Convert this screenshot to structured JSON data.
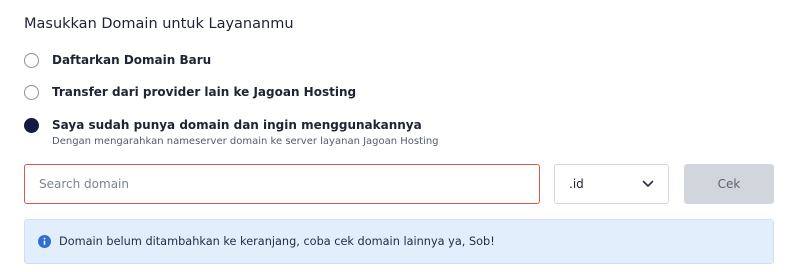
{
  "heading": "Masukkan Domain untuk Layananmu",
  "options": [
    {
      "label": "Daftarkan Domain Baru",
      "checked": false
    },
    {
      "label": "Transfer dari provider lain ke Jagoan Hosting",
      "checked": false
    },
    {
      "label": "Saya sudah punya domain dan ingin menggunakannya",
      "sublabel": "Dengan mengarahkan nameserver domain ke server layanan Jagoan Hosting",
      "checked": true
    }
  ],
  "search": {
    "placeholder": "Search domain",
    "value": "",
    "border_color": "#e0524d"
  },
  "tld_select": {
    "value": ".id",
    "icon": "chevron-down-icon"
  },
  "check_button": {
    "label": "Cek"
  },
  "alert": {
    "icon": "info-icon",
    "text": "Domain belum ditambahkan ke keranjang, coba cek domain lainnya ya, Sob!",
    "background": "#e3eefc"
  },
  "colors": {
    "radio_checked": "#151a45",
    "info_icon": "#2f6fd1",
    "button_bg": "#d2d5db"
  }
}
